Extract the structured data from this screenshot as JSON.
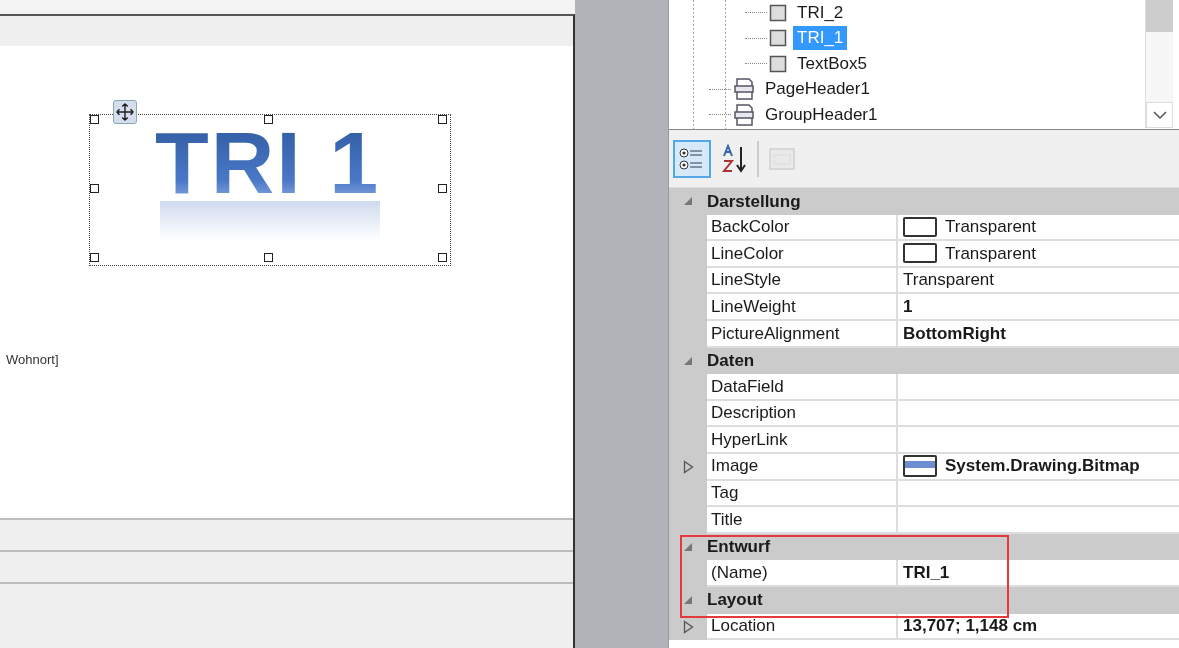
{
  "designer": {
    "image_text": "TRI 1",
    "field_text": "Wohnort]"
  },
  "tree": {
    "items": [
      {
        "children": [
          {
            "label": "TRI_2",
            "kind": "control",
            "selected": false
          },
          {
            "label": "TRI_1",
            "kind": "control",
            "selected": true
          },
          {
            "label": "TextBox5",
            "kind": "control",
            "selected": false
          }
        ]
      },
      {
        "label": "PageHeader1",
        "kind": "section",
        "selected": false
      },
      {
        "label": "GroupHeader1",
        "kind": "section",
        "selected": false
      }
    ]
  },
  "toolbar": [
    {
      "kind": "categorized",
      "selected": true,
      "disabled": false
    },
    {
      "kind": "alphabetical",
      "selected": false,
      "disabled": false
    },
    {
      "kind": "property-pages",
      "selected": false,
      "disabled": true
    }
  ],
  "categories": [
    {
      "title": "Darstellung",
      "expanded": true,
      "properties": [
        {
          "name": "BackColor",
          "value": "Transparent",
          "kind": "color",
          "modified": false,
          "expandable": false
        },
        {
          "name": "LineColor",
          "value": "Transparent",
          "kind": "color",
          "modified": false,
          "expandable": false
        },
        {
          "name": "LineStyle",
          "value": "Transparent",
          "modified": false,
          "expandable": false
        },
        {
          "name": "LineWeight",
          "value": "1",
          "modified": true,
          "expandable": false
        },
        {
          "name": "PictureAlignment",
          "value": "BottomRight",
          "modified": true,
          "expandable": false
        }
      ]
    },
    {
      "title": "Daten",
      "expanded": true,
      "properties": [
        {
          "name": "DataField",
          "modified": false,
          "expandable": false
        },
        {
          "name": "Description",
          "modified": false,
          "expandable": false
        },
        {
          "name": "HyperLink",
          "modified": false,
          "expandable": false
        },
        {
          "name": "Image",
          "value": "System.Drawing.Bitmap",
          "kind": "image",
          "modified": true,
          "expandable": true
        },
        {
          "name": "Tag",
          "modified": false,
          "expandable": false
        },
        {
          "name": "Title",
          "modified": false,
          "expandable": false
        }
      ]
    },
    {
      "title": "Entwurf",
      "expanded": true,
      "properties": [
        {
          "name": "(Name)",
          "value": "TRI_1",
          "modified": true,
          "expandable": false
        }
      ]
    },
    {
      "title": "Layout",
      "expanded": true,
      "properties": [
        {
          "name": "Location",
          "value": "13,707; 1,148 cm",
          "modified": true,
          "expandable": true
        }
      ]
    }
  ]
}
